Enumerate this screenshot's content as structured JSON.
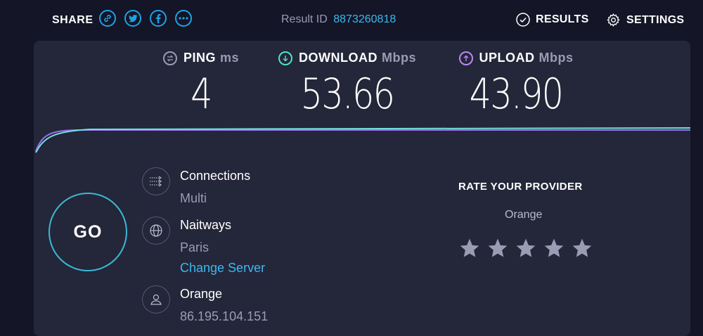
{
  "header": {
    "share_label": "SHARE",
    "share_icons": [
      "link-icon",
      "twitter-icon",
      "facebook-icon",
      "more-icon"
    ],
    "result_id_label": "Result ID",
    "result_id_value": "8873260818",
    "results_label": "RESULTS",
    "settings_label": "SETTINGS"
  },
  "metrics": {
    "ping": {
      "label": "PING",
      "unit": "ms",
      "value": "4",
      "color": "#9a9cb4"
    },
    "download": {
      "label": "DOWNLOAD",
      "unit": "Mbps",
      "value": "53.66",
      "color": "#50e3c2"
    },
    "upload": {
      "label": "UPLOAD",
      "unit": "Mbps",
      "value": "43.90",
      "color": "#b78bf6"
    }
  },
  "graph": {
    "download_color": "#6fe0dd",
    "upload_color": "#9b6ff0"
  },
  "info": {
    "connections": {
      "title": "Connections",
      "value": "Multi"
    },
    "server": {
      "title": "Naitways",
      "location": "Paris",
      "change_label": "Change Server"
    },
    "isp": {
      "title": "Orange",
      "ip": "86.195.104.151"
    }
  },
  "go_label": "GO",
  "rating": {
    "title": "RATE YOUR PROVIDER",
    "provider": "Orange",
    "max_stars": 5,
    "selected_stars": 0
  },
  "colors": {
    "background": "#141526",
    "panel": "#242639",
    "accent": "#3cb9f0"
  }
}
